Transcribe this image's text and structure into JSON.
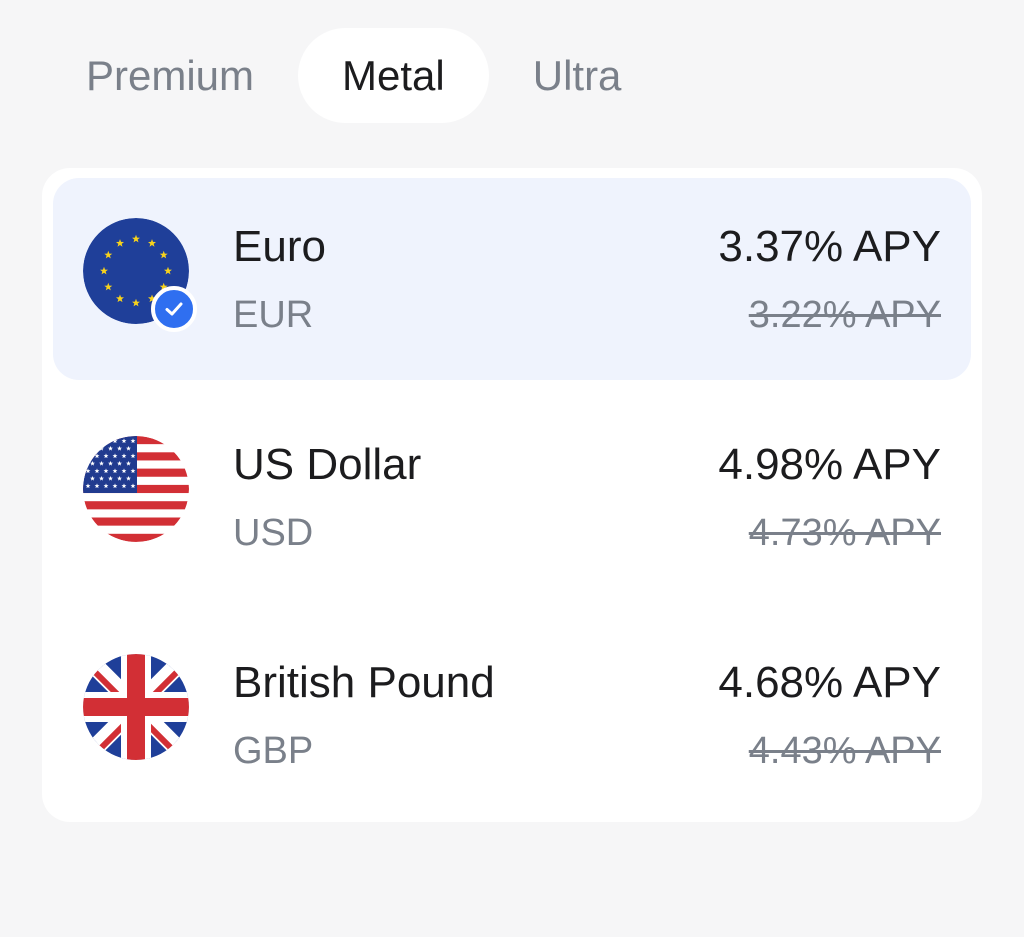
{
  "tabs": [
    {
      "label": "Premium",
      "active": false
    },
    {
      "label": "Metal",
      "active": true
    },
    {
      "label": "Ultra",
      "active": false
    }
  ],
  "currencies": [
    {
      "name": "Euro",
      "code": "EUR",
      "rate": "3.37% APY",
      "old_rate": "3.22% APY",
      "flag_icon": "eu-flag-icon",
      "selected": true
    },
    {
      "name": "US Dollar",
      "code": "USD",
      "rate": "4.98% APY",
      "old_rate": "4.73% APY",
      "flag_icon": "us-flag-icon",
      "selected": false
    },
    {
      "name": "British Pound",
      "code": "GBP",
      "rate": "4.68% APY",
      "old_rate": "4.43% APY",
      "flag_icon": "uk-flag-icon",
      "selected": false
    }
  ],
  "colors": {
    "accent": "#2f6ff0",
    "selected_row": "#eff3fd",
    "muted_text": "#7a808a",
    "background": "#f6f6f7"
  }
}
